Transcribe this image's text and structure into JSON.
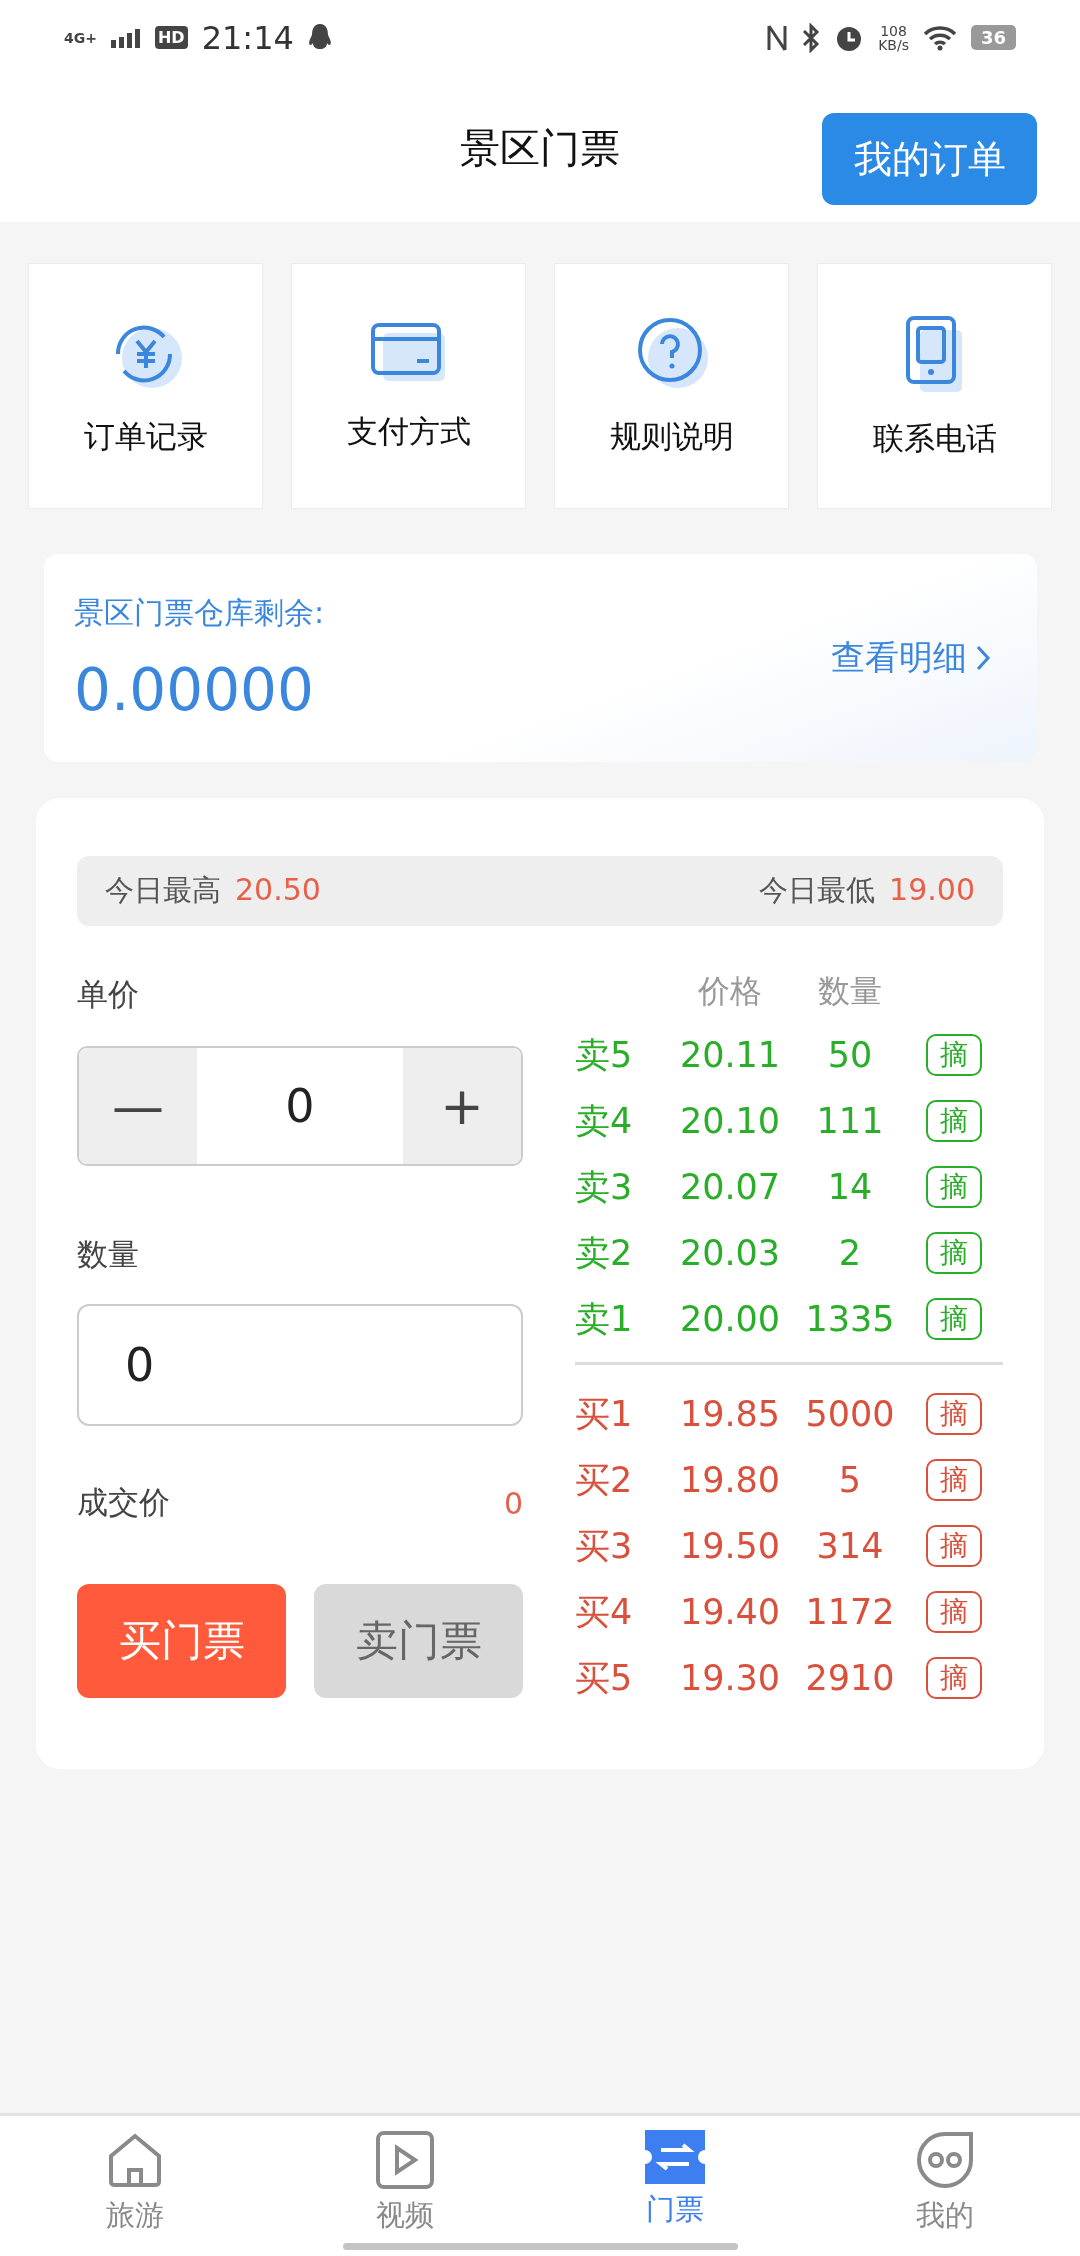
{
  "status_bar": {
    "network": "4G+",
    "hd": "HD",
    "time": "21:14",
    "speed": "108",
    "speed_unit": "KB/s",
    "battery": "36"
  },
  "header": {
    "title": "景区门票",
    "action": "我的订单"
  },
  "shortcuts": [
    {
      "kind": "yuan",
      "label": "订单记录"
    },
    {
      "kind": "card",
      "label": "支付方式"
    },
    {
      "kind": "help",
      "label": "规则说明"
    },
    {
      "kind": "phone",
      "label": "联系电话"
    }
  ],
  "warehouse": {
    "label": "景区门票仓库剩余:",
    "value": "0.00000",
    "link": "查看明细"
  },
  "today": {
    "high_label": "今日最高",
    "high": "20.50",
    "low_label": "今日最低",
    "low": "19.00"
  },
  "form": {
    "price_label": "单价",
    "minus": "—",
    "price": "0",
    "plus": "+",
    "qty_label": "数量",
    "qty": "0",
    "deal_label": "成交价",
    "deal": "0",
    "buy": "买门票",
    "sell": "卖门票"
  },
  "order_book": {
    "columns": [
      "价格",
      "数量"
    ],
    "asks": [
      {
        "label": "卖5",
        "price": "20.11",
        "qty": "50",
        "action": "摘"
      },
      {
        "label": "卖4",
        "price": "20.10",
        "qty": "111",
        "action": "摘"
      },
      {
        "label": "卖3",
        "price": "20.07",
        "qty": "14",
        "action": "摘"
      },
      {
        "label": "卖2",
        "price": "20.03",
        "qty": "2",
        "action": "摘"
      },
      {
        "label": "卖1",
        "price": "20.00",
        "qty": "1335",
        "action": "摘"
      }
    ],
    "bids": [
      {
        "label": "买1",
        "price": "19.85",
        "qty": "5000",
        "action": "摘"
      },
      {
        "label": "买2",
        "price": "19.80",
        "qty": "5",
        "action": "摘"
      },
      {
        "label": "买3",
        "price": "19.50",
        "qty": "314",
        "action": "摘"
      },
      {
        "label": "买4",
        "price": "19.40",
        "qty": "1172",
        "action": "摘"
      },
      {
        "label": "买5",
        "price": "19.30",
        "qty": "2910",
        "action": "摘"
      }
    ]
  },
  "tab_bar": [
    {
      "kind": "home",
      "label": "旅游",
      "selected": false
    },
    {
      "kind": "video",
      "label": "视频",
      "selected": false
    },
    {
      "kind": "ticket",
      "label": "门票",
      "selected": true
    },
    {
      "kind": "face",
      "label": "我的",
      "selected": false
    }
  ]
}
